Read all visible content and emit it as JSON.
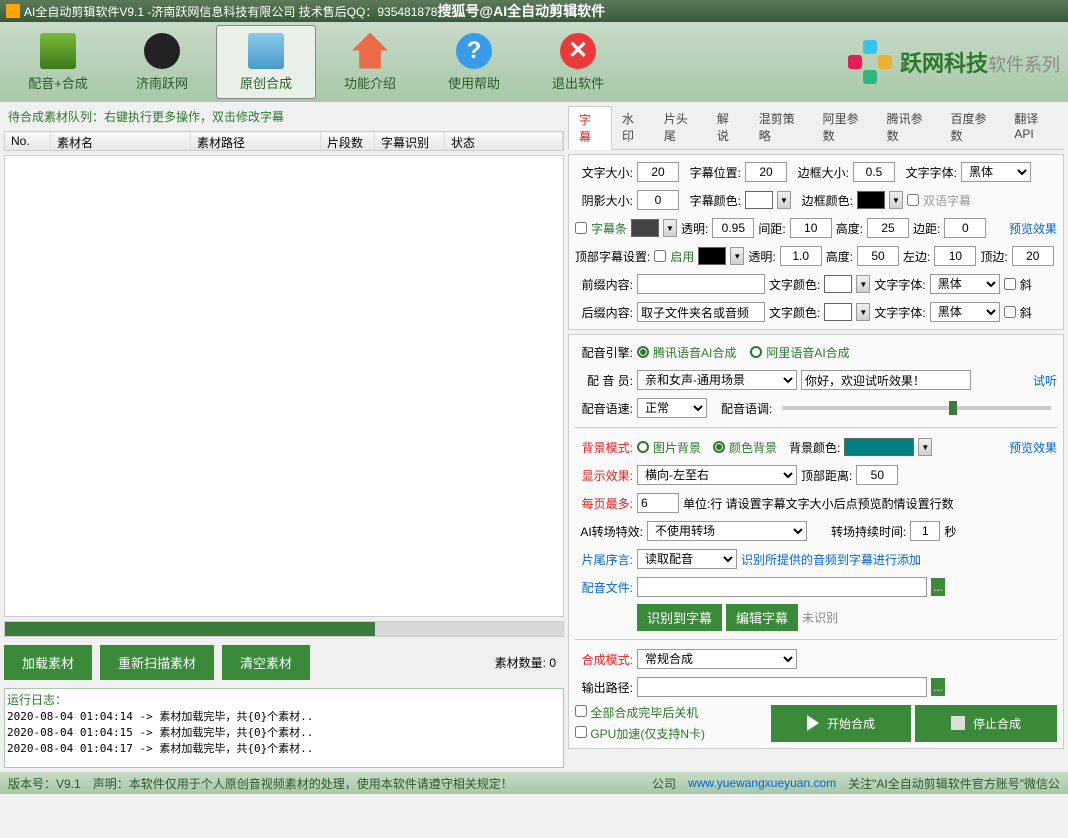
{
  "title": "AI全自动剪辑软件V9.1 -济南跃网信息科技有限公司 技术售后QQ：935481878",
  "titleRight": "搜狐号@AI全自动剪辑软件",
  "toolbar": [
    {
      "label": "配音+合成"
    },
    {
      "label": "济南跃网"
    },
    {
      "label": "原创合成"
    },
    {
      "label": "功能介绍"
    },
    {
      "label": "使用帮助"
    },
    {
      "label": "退出软件"
    }
  ],
  "brand": {
    "name": "跃网科技",
    "suffix": "软件系列"
  },
  "hint": "待合成素材队列：右键执行更多操作，双击修改字幕",
  "cols": [
    "No.",
    "素材名",
    "素材路径",
    "片段数",
    "字幕识别",
    "状态"
  ],
  "btns": {
    "load": "加载素材",
    "rescan": "重新扫描素材",
    "clear": "清空素材"
  },
  "countLabel": "素材数量:",
  "countVal": "0",
  "logTitle": "运行日志：",
  "logs": [
    "2020-08-04 01:04:14 -> 素材加载完毕，共{0}个素材..",
    "2020-08-04 01:04:15 -> 素材加载完毕，共{0}个素材..",
    "2020-08-04 01:04:17 -> 素材加载完毕，共{0}个素材.."
  ],
  "tabs": [
    "字幕",
    "水印",
    "片头尾",
    "解说",
    "混剪策略",
    "阿里参数",
    "腾讯参数",
    "百度参数",
    "翻译API"
  ],
  "s": {
    "fontSize": "文字大小:",
    "fontSizeV": "20",
    "pos": "字幕位置:",
    "posV": "20",
    "border": "边框大小:",
    "borderV": "0.5",
    "font": "文字字体:",
    "fontV": "黑体",
    "shadow": "阴影大小:",
    "shadowV": "0",
    "color": "字幕颜色:",
    "borderColor": "边框颜色:",
    "bilingual": "双语字幕",
    "bar": "字幕条",
    "alpha": "透明:",
    "alphaV": "0.95",
    "gap": "间距:",
    "gapV": "10",
    "h": "高度:",
    "hV": "25",
    "edge": "边距:",
    "edgeV": "0",
    "preview": "预览效果",
    "top": "顶部字幕设置:",
    "enable": "启用",
    "alphaV2": "1.0",
    "hV2": "50",
    "left": "左边:",
    "leftV": "10",
    "topm": "顶边:",
    "topmV": "20",
    "prefix": "前缀内容:",
    "tcolor": "文字颜色:",
    "italic": "斜",
    "suffix": "后缀内容:",
    "suffixV": "取子文件夹名或音频"
  },
  "v": {
    "engine": "配音引擎:",
    "radio1": "腾讯语音AI合成",
    "radio2": "阿里语音AI合成",
    "voice": "配 音 员:",
    "voiceV": "亲和女声-通用场景",
    "sample": "你好，欢迎试听效果！",
    "test": "试听",
    "speed": "配音语速:",
    "speedV": "正常",
    "pitch": "配音语调:",
    "bgmode": "背景模式:",
    "r1": "图片背景",
    "r2": "颜色背景",
    "bgcolor": "背景颜色:",
    "show": "显示效果:",
    "showV": "横向-左至右",
    "topdist": "顶部距离:",
    "topdistV": "50",
    "maxrow": "每页最多:",
    "maxrowV": "6",
    "maxhint": "单位:行 请设置字幕文字大小后点预览酌情设置行数",
    "trans": "AI转场特效:",
    "transV": "不使用转场",
    "dur": "转场持续时间:",
    "durV": "1",
    "sec": "秒",
    "tail": "片尾序言:",
    "tailV": "读取配音",
    "tailhint": "识别所提供的音频到字幕进行添加",
    "audio": "配音文件:",
    "btn1": "识别到字幕",
    "btn2": "编辑字幕",
    "unrec": "未识别",
    "mode": "合成模式:",
    "modeV": "常规合成",
    "out": "输出路径:",
    "cb1": "全部合成完毕后关机",
    "cb2": "GPU加速(仅支持N卡)",
    "start": "开始合成",
    "stop": "停止合成"
  },
  "foot": {
    "ver": "版本号：V9.1",
    "decl": "声明：本软件仅用于个人原创音视频素材的处理，使用本软件请遵守相关规定！",
    "co": "公司",
    "url": "www.yuewangxueyuan.com",
    "tail": "关注\"AI全自动剪辑软件官方账号\"微信公"
  }
}
